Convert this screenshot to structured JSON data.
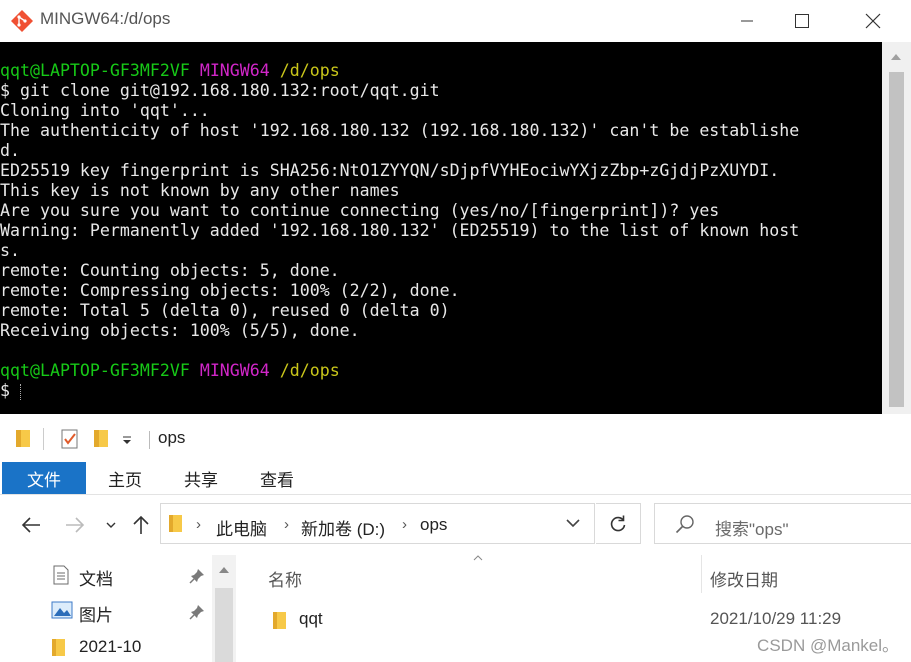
{
  "terminal": {
    "title": "MINGW64:/d/ops",
    "prompt1": {
      "user": "qqt@LAPTOP-GF3MF2VF",
      "shell": "MINGW64",
      "path": "/d/ops"
    },
    "lines": [
      "$ git clone git@192.168.180.132:root/qqt.git",
      "Cloning into 'qqt'...",
      "The authenticity of host '192.168.180.132 (192.168.180.132)' can't be establishe",
      "d.",
      "ED25519 key fingerprint is SHA256:NtO1ZYYQN/sDjpfVYHEociwYXjzZbp+zGjdjPzXUYDI.",
      "This key is not known by any other names",
      "Are you sure you want to continue connecting (yes/no/[fingerprint])? yes",
      "Warning: Permanently added '192.168.180.132' (ED25519) to the list of known host",
      "s.",
      "remote: Counting objects: 5, done.",
      "remote: Compressing objects: 100% (2/2), done.",
      "remote: Total 5 (delta 0), reused 0 (delta 0)",
      "Receiving objects: 100% (5/5), done."
    ],
    "prompt2": {
      "user": "qqt@LAPTOP-GF3MF2VF",
      "shell": "MINGW64",
      "path": "/d/ops"
    },
    "final_prompt": "$",
    "colors": {
      "user": "#17c917",
      "shell": "#d126c8",
      "path": "#c9c61a",
      "background": "#000000"
    }
  },
  "explorer": {
    "window_title": "ops",
    "tabs": {
      "file": "文件",
      "home": "主页",
      "share": "共享",
      "view": "查看"
    },
    "breadcrumb": [
      "此电脑",
      "新加卷 (D:)",
      "ops"
    ],
    "search_placeholder": "搜索\"ops\"",
    "sidebar": [
      {
        "label": "文档",
        "icon": "document-icon",
        "pinned": true
      },
      {
        "label": "图片",
        "icon": "picture-icon",
        "pinned": true
      },
      {
        "label": "2021-10",
        "icon": "folder-icon",
        "pinned": false
      }
    ],
    "columns": {
      "name": "名称",
      "modified": "修改日期"
    },
    "files": [
      {
        "name": "qqt",
        "modified": "2021/10/29 11:29",
        "icon": "folder-icon"
      }
    ],
    "accent_color": "#1a73c7"
  },
  "watermark": "CSDN @Mankel。"
}
